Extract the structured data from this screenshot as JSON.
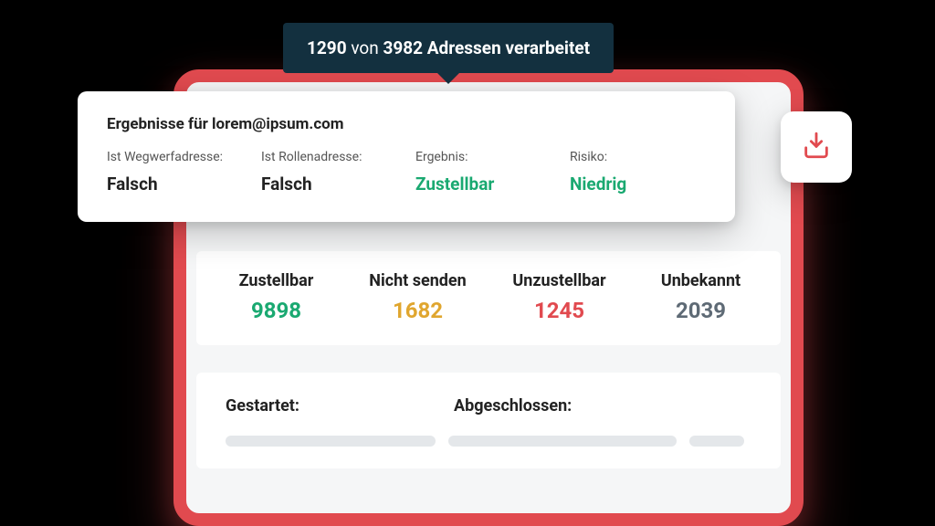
{
  "progress": {
    "processed": "1290",
    "separator": "von",
    "total": "3982",
    "suffix": "Adressen verarbeitet"
  },
  "result": {
    "title": "Ergebnisse für lorem@ipsum.com",
    "fields": [
      {
        "label": "Ist Wegwerfadresse:",
        "value": "Falsch",
        "color": "dark"
      },
      {
        "label": "Ist Rollenadresse:",
        "value": "Falsch",
        "color": "dark"
      },
      {
        "label": "Ergebnis:",
        "value": "Zustellbar",
        "color": "green"
      },
      {
        "label": "Risiko:",
        "value": "Niedrig",
        "color": "green"
      }
    ]
  },
  "download_icon": "download-tray-icon",
  "stats": [
    {
      "label": "Zustellbar",
      "value": "9898",
      "color": "green"
    },
    {
      "label": "Nicht senden",
      "value": "1682",
      "color": "yellow"
    },
    {
      "label": "Unzustellbar",
      "value": "1245",
      "color": "red"
    },
    {
      "label": "Unbekannt",
      "value": "2039",
      "color": "gray"
    }
  ],
  "timeline": {
    "started_label": "Gestartet:",
    "completed_label": "Abgeschlossen:"
  },
  "colors": {
    "accent_red": "#e14a4f",
    "success_green": "#1aa971",
    "warn_yellow": "#e0a62f",
    "neutral_gray": "#5e6a75",
    "tooltip_bg": "#13303f"
  }
}
